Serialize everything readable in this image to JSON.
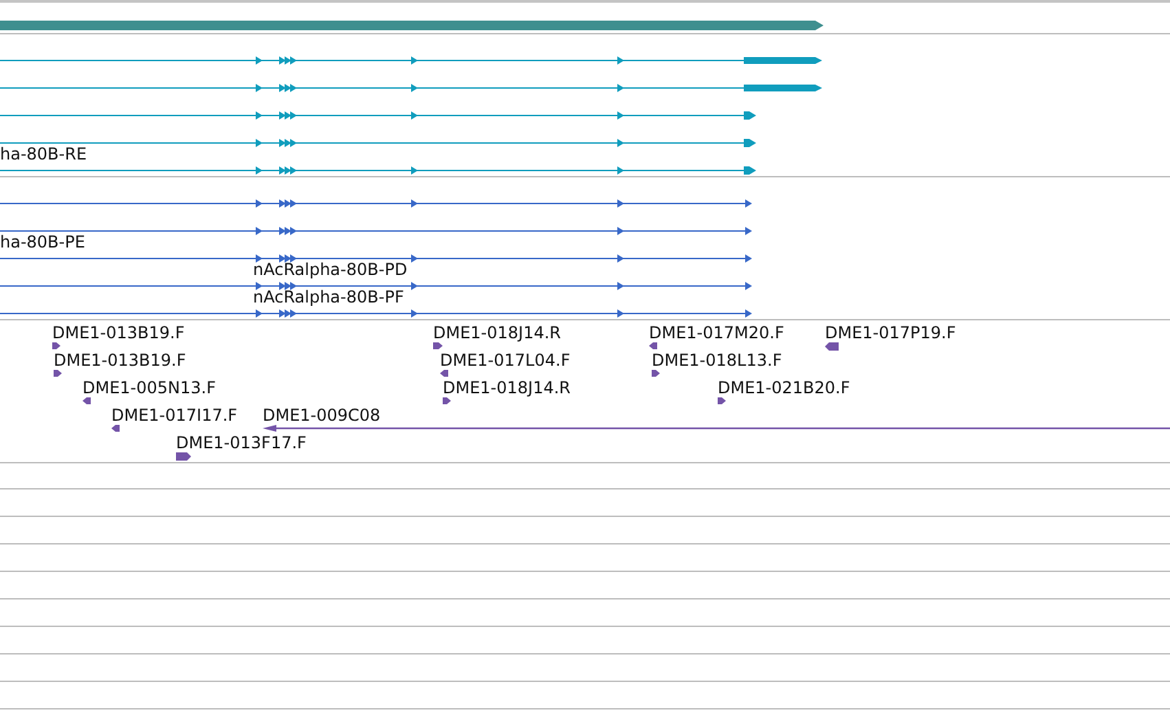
{
  "tracks": [
    {
      "kind": "gene",
      "features": [
        {
          "reverse": false
        }
      ]
    },
    {
      "kind": "transcripts",
      "features": [
        {
          "reverse": false
        },
        {
          "reverse": false
        },
        {
          "reverse": false
        },
        {
          "reverse": false,
          "label": "ha-80B-RE"
        },
        {
          "reverse": false
        }
      ]
    },
    {
      "kind": "proteins",
      "features": [
        {
          "reverse": false
        },
        {
          "reverse": false,
          "label": "ha-80B-PE"
        },
        {
          "reverse": false,
          "label": "nAcRalpha-80B-PD"
        },
        {
          "reverse": false,
          "label": "nAcRalpha-80B-PF"
        },
        {
          "reverse": false
        }
      ]
    },
    {
      "kind": "ests",
      "features": [
        {
          "label": "DME1-013B19.F",
          "reverse": false
        },
        {
          "label": "DME1-013B19.F",
          "reverse": false
        },
        {
          "label": "DME1-005N13.F",
          "reverse": true
        },
        {
          "label": "DME1-017I17.F",
          "reverse": true
        },
        {
          "label": "DME1-009C08",
          "reverse": true
        },
        {
          "label": "DME1-013F17.F",
          "reverse": false
        },
        {
          "label": "DME1-018J14.R",
          "reverse": false
        },
        {
          "label": "DME1-017L04.F",
          "reverse": true
        },
        {
          "label": "DME1-018J14.R",
          "reverse": false
        },
        {
          "label": "DME1-017M20.F",
          "reverse": true
        },
        {
          "label": "DME1-018L13.F",
          "reverse": false
        },
        {
          "label": "DME1-021B20.F",
          "reverse": false
        },
        {
          "label": "DME1-017P19.F",
          "reverse": true
        }
      ]
    }
  ]
}
